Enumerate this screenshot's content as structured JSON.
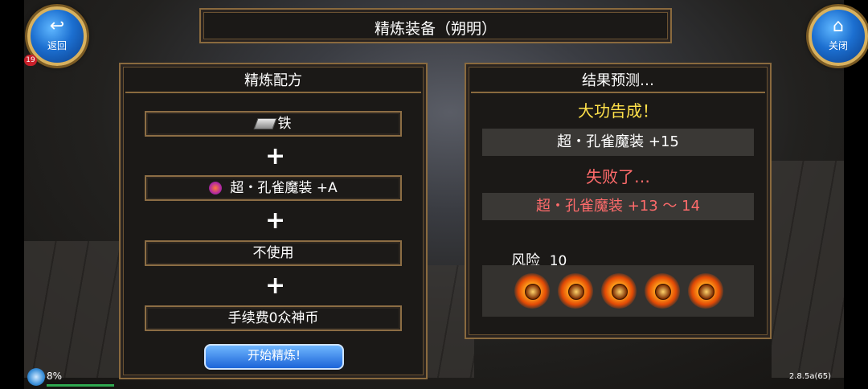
{
  "header": {
    "title": "精炼装备（朔明）"
  },
  "nav": {
    "back_glyph": "↩",
    "back_label": "返回",
    "close_glyph": "⌂",
    "close_label": "关闭",
    "badge": "19"
  },
  "recipe": {
    "title": "精炼配方",
    "material": "铁",
    "equipment": "超・孔雀魔装 +A",
    "option": "不使用",
    "fee": "手续费0众神币",
    "plus": "+",
    "start_button": "开始精炼!"
  },
  "result": {
    "title": "结果预测…",
    "success_label": "大功告成！",
    "success_item": "超・孔雀魔装 +15",
    "fail_label": "失败了…",
    "fail_item": "超・孔雀魔装 +13 ～ 14",
    "risk_label": "风险",
    "risk_value": "10",
    "risk_gems": 5
  },
  "status": {
    "battery": "8%",
    "version": "2.8.5a(65)"
  },
  "colors": {
    "success": "#ffe14a",
    "fail": "#ff6b6b",
    "accent": "#c69a52"
  }
}
